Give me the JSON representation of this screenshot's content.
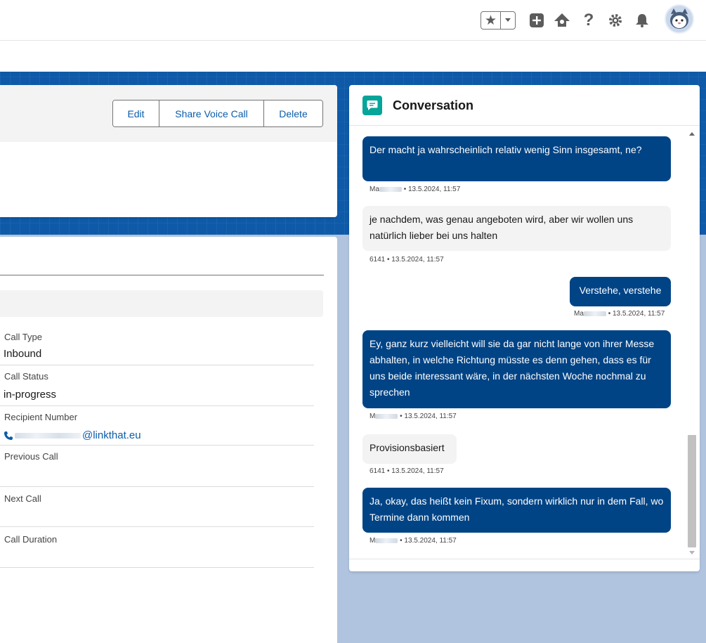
{
  "header": {
    "icons": [
      "star-icon",
      "chevron-down-icon",
      "add-icon",
      "trailhead-icon",
      "help-icon",
      "gear-icon",
      "bell-icon",
      "avatar"
    ]
  },
  "highlights": {
    "actions": {
      "edit": "Edit",
      "share": "Share Voice Call",
      "delete": "Delete"
    }
  },
  "details": {
    "fields": [
      {
        "label": "Call Type",
        "value": "Inbound"
      },
      {
        "label": "Call Status",
        "value": "in-progress"
      },
      {
        "label": "Recipient Number",
        "value": "@linkthat.eu"
      },
      {
        "label": "Previous Call",
        "value": ""
      },
      {
        "label": "Next Call",
        "value": ""
      },
      {
        "label": "Call Duration",
        "value": ""
      }
    ]
  },
  "conversation": {
    "title": "Conversation",
    "messages": [
      {
        "direction": "outgoing",
        "text": "Der macht ja wahrscheinlich relativ wenig Sinn insgesamt, ne?",
        "sender_prefix": "Ma",
        "meta": "• 13.5.2024, 11:57"
      },
      {
        "direction": "incoming",
        "text": "je nachdem, was genau angeboten wird, aber wir wollen uns natürlich lieber bei uns halten",
        "sender": "6141",
        "meta": "6141 • 13.5.2024, 11:57"
      },
      {
        "direction": "outgoing",
        "text": "Verstehe, verstehe",
        "sender_prefix": "Ma",
        "meta": "• 13.5.2024, 11:57"
      },
      {
        "direction": "outgoing",
        "text": "Ey, ganz kurz vielleicht will sie da gar nicht lange von ihrer Messe abhalten, in welche Richtung müsste es denn gehen, dass es für uns beide interessant wäre, in der nächsten Woche nochmal zu sprechen",
        "sender_prefix": "M",
        "meta": "• 13.5.2024, 11:57"
      },
      {
        "direction": "incoming",
        "text": "Provisionsbasiert",
        "sender": "6141",
        "meta": "6141 • 13.5.2024, 11:57"
      },
      {
        "direction": "outgoing",
        "text": "Ja, okay, das heißt kein Fixum, sondern wirklich nur in dem Fall, wo Termine dann kommen",
        "sender_prefix": "M",
        "meta": "• 13.5.2024, 11:57"
      }
    ]
  },
  "colors": {
    "brand_blue": "#0b5cab",
    "bubble_out": "#014486",
    "bubble_in": "#f3f3f3",
    "conversation_icon": "#06a59a",
    "band": "#0e5aa8",
    "page_bg": "#b0c4df"
  }
}
